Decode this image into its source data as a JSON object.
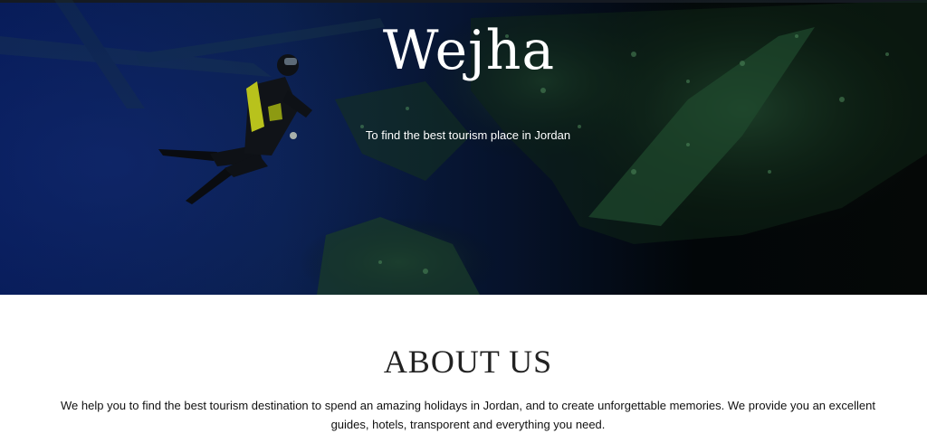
{
  "hero": {
    "title": "Wejha",
    "subtitle": "To find the best tourism place in Jordan",
    "image_icon": "scuba-diver-shipwreck-image"
  },
  "about": {
    "heading": "ABOUT US",
    "text": "We help you to find the best tourism destination to spend an amazing holidays in Jordan, and to create unforgettable memories. We provide you an excellent guides, hotels, transporent and everything you need."
  },
  "colors": {
    "ocean_blue": "#061a56",
    "deep_dark": "#020608",
    "coral_green": "#2f6b45",
    "text_dark": "#222222",
    "white": "#ffffff"
  }
}
